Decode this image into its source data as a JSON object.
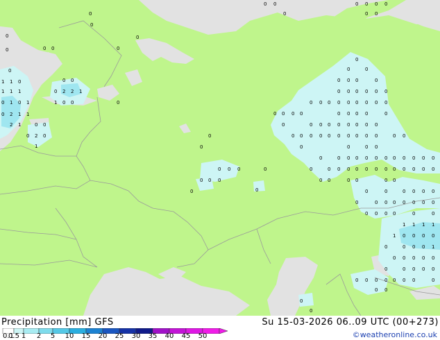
{
  "map": {
    "colors": {
      "land": "#bff58c",
      "sea": "#e2e2e2",
      "border": "#9a9a9a",
      "coast": "#7a7a7a",
      "precip_light": "#cdf5f5",
      "precip_mid": "#9fe6f0",
      "precip_heavy": "#5fcfe6"
    },
    "precip_values_shown": [
      "0",
      "1",
      "2",
      "0",
      "1"
    ]
  },
  "footer": {
    "title": "Precipitation [mm]  GFS",
    "datetime": "Su 15-03-2026 06..09 UTC (00+273)",
    "credit": "©weatheronline.co.uk",
    "scale_ticks": [
      "0.1",
      "0.5",
      "1",
      "2",
      "5",
      "10",
      "15",
      "20",
      "25",
      "30",
      "35",
      "40",
      "45",
      "50"
    ],
    "scale_colors": [
      "#ffffff",
      "#cdf5f5",
      "#a8ecf2",
      "#7fdcec",
      "#55c8e6",
      "#2aaee0",
      "#1c82d2",
      "#1a56c0",
      "#1632a6",
      "#101a8a",
      "#a012c8",
      "#c214d6",
      "#de18e4",
      "#f01ce8"
    ]
  }
}
